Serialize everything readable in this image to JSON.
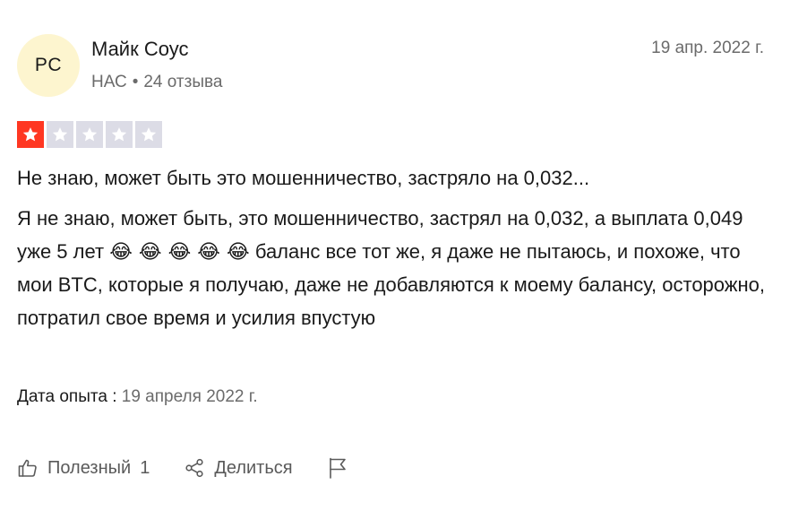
{
  "reviewer": {
    "initials": "PC",
    "name": "Майк Соус",
    "country": "НАС",
    "separator": "•",
    "reviews_count": "24 отзыва"
  },
  "review": {
    "date": "19 апр. 2022 г.",
    "rating": 1,
    "rating_max": 5,
    "title": "Не знаю, может быть это мошенничество, застряло на 0,032...",
    "body_part1": "Я не знаю, может быть, это мошенничество, застрял на 0,032, а выплата 0,049 уже 5 лет",
    "emojis": "😂 😂 😂 😂 😂",
    "body_part2": "баланс все тот же, я даже не пытаюсь, и похоже, что мои BTC, которые я получаю, даже не добавляются к моему балансу, осторожно, потратил свое время и усилия впустую",
    "experience_label": "Дата опыта :",
    "experience_date": "19 апреля 2022 г."
  },
  "actions": {
    "useful_label": "Полезный",
    "useful_count": "1",
    "share_label": "Делиться"
  },
  "colors": {
    "star_filled": "#ff3722",
    "star_empty": "#dcdce6",
    "avatar_bg": "#fdf5cf",
    "muted_text": "#6b6b6b"
  },
  "icons": {
    "useful": "thumbs-up-icon",
    "share": "share-icon",
    "report": "flag-icon",
    "star": "star-icon"
  }
}
